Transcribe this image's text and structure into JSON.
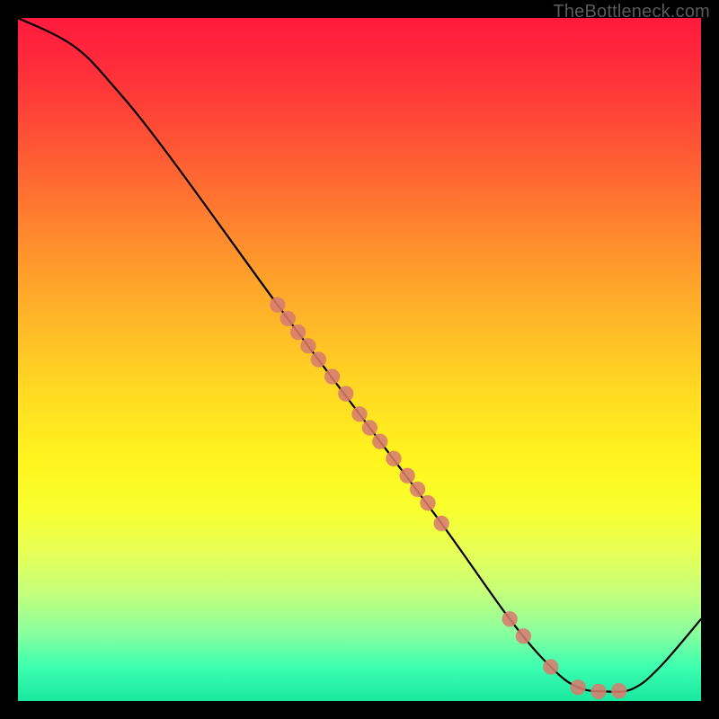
{
  "watermark": "TheBottleneck.com",
  "chart_data": {
    "type": "line",
    "title": "",
    "xlabel": "",
    "ylabel": "",
    "xlim": [
      0,
      100
    ],
    "ylim": [
      0,
      100
    ],
    "curve": [
      {
        "x": 0,
        "y": 100
      },
      {
        "x": 8,
        "y": 96
      },
      {
        "x": 14,
        "y": 90
      },
      {
        "x": 22,
        "y": 80
      },
      {
        "x": 38,
        "y": 58
      },
      {
        "x": 50,
        "y": 42
      },
      {
        "x": 62,
        "y": 26
      },
      {
        "x": 72,
        "y": 12
      },
      {
        "x": 78,
        "y": 5
      },
      {
        "x": 82,
        "y": 2
      },
      {
        "x": 86,
        "y": 1.4
      },
      {
        "x": 90,
        "y": 1.8
      },
      {
        "x": 94,
        "y": 5
      },
      {
        "x": 100,
        "y": 12
      }
    ],
    "points": [
      {
        "x": 38,
        "y": 58
      },
      {
        "x": 39.5,
        "y": 56
      },
      {
        "x": 41,
        "y": 54
      },
      {
        "x": 42.5,
        "y": 52
      },
      {
        "x": 44,
        "y": 50
      },
      {
        "x": 46,
        "y": 47.5
      },
      {
        "x": 48,
        "y": 45
      },
      {
        "x": 50,
        "y": 42
      },
      {
        "x": 51.5,
        "y": 40
      },
      {
        "x": 53,
        "y": 38
      },
      {
        "x": 55,
        "y": 35.5
      },
      {
        "x": 57,
        "y": 33
      },
      {
        "x": 58.5,
        "y": 31
      },
      {
        "x": 60,
        "y": 29
      },
      {
        "x": 62,
        "y": 26
      },
      {
        "x": 72,
        "y": 12
      },
      {
        "x": 74,
        "y": 9.5
      },
      {
        "x": 78,
        "y": 5
      },
      {
        "x": 82,
        "y": 2
      },
      {
        "x": 85,
        "y": 1.4
      },
      {
        "x": 88,
        "y": 1.5
      }
    ]
  }
}
